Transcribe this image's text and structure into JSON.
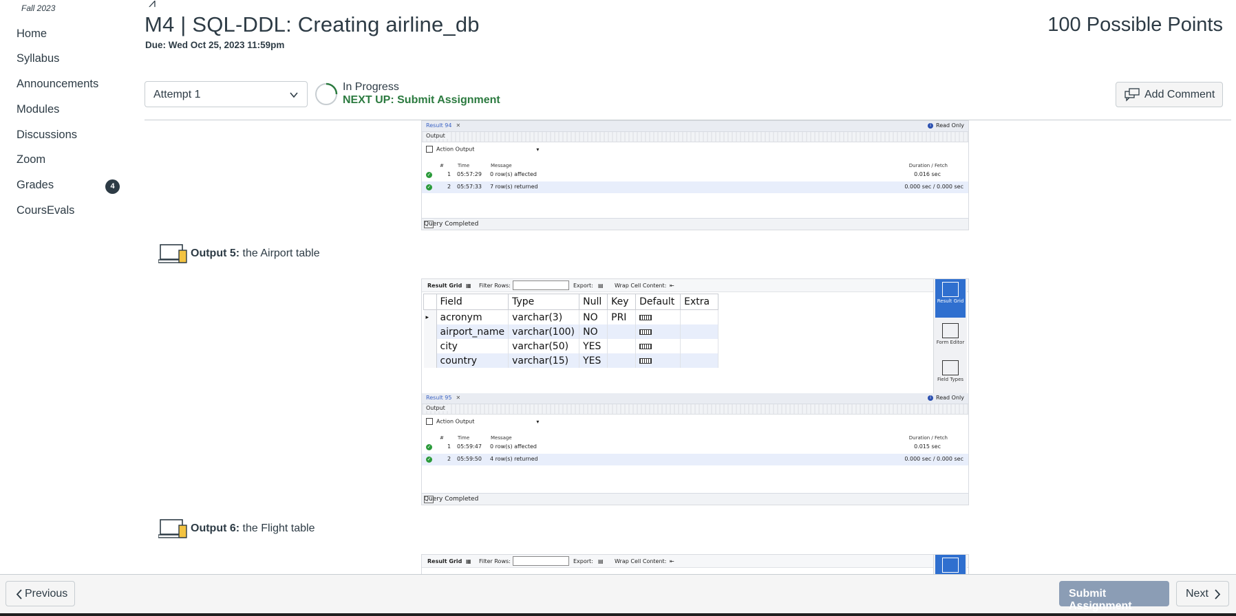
{
  "course": {
    "term": "Fall 2023",
    "nav": [
      {
        "label": "Home"
      },
      {
        "label": "Syllabus"
      },
      {
        "label": "Announcements"
      },
      {
        "label": "Modules"
      },
      {
        "label": "Discussions"
      },
      {
        "label": "Zoom"
      },
      {
        "label": "Grades",
        "badge": "4"
      },
      {
        "label": "CoursEvals"
      }
    ]
  },
  "header": {
    "title": "M4 | SQL-DDL: Creating airline_db",
    "due": "Due: Wed Oct 25, 2023 11:59pm",
    "points": "100 Possible Points"
  },
  "attempt": {
    "selected": "Attempt 1",
    "status": "In Progress",
    "next_up": "NEXT UP: Submit Assignment",
    "add_comment": "Add Comment"
  },
  "output4_panel": {
    "tab": "Result 94",
    "read_only": "Read Only",
    "output_label": "Output",
    "action_output": "Action Output",
    "headers": {
      "num": "#",
      "time": "Time",
      "message": "Message",
      "duration": "Duration / Fetch"
    },
    "rows": [
      {
        "num": "1",
        "time": "05:57:29",
        "message": "0 row(s) affected",
        "duration": "0.016 sec"
      },
      {
        "num": "2",
        "time": "05:57:33",
        "message": "7 row(s) returned",
        "duration": "0.000 sec / 0.000 sec"
      }
    ],
    "status": "Query Completed"
  },
  "output5": {
    "prefix": "Output 5:",
    "caption": "the Airport table",
    "toolbar": {
      "result_grid": "Result Grid",
      "filter_rows": "Filter Rows:",
      "export": "Export:",
      "wrap": "Wrap Cell Content:"
    },
    "side": {
      "result_grid": "Result Grid",
      "form_editor": "Form Editor",
      "field_types": "Field Types"
    },
    "columns": [
      "Field",
      "Type",
      "Null",
      "Key",
      "Default",
      "Extra"
    ],
    "rows": [
      {
        "field": "acronym",
        "type": "varchar(3)",
        "null": "NO",
        "key": "PRI"
      },
      {
        "field": "airport_name",
        "type": "varchar(100)",
        "null": "NO",
        "key": ""
      },
      {
        "field": "city",
        "type": "varchar(50)",
        "null": "YES",
        "key": ""
      },
      {
        "field": "country",
        "type": "varchar(15)",
        "null": "YES",
        "key": ""
      }
    ],
    "panel": {
      "tab": "Result 95",
      "read_only": "Read Only",
      "output_label": "Output",
      "action_output": "Action Output",
      "headers": {
        "num": "#",
        "time": "Time",
        "message": "Message",
        "duration": "Duration / Fetch"
      },
      "rows": [
        {
          "num": "1",
          "time": "05:59:47",
          "message": "0 row(s) affected",
          "duration": "0.015 sec"
        },
        {
          "num": "2",
          "time": "05:59:50",
          "message": "4 row(s) returned",
          "duration": "0.000 sec / 0.000 sec"
        }
      ],
      "status": "Query Completed"
    }
  },
  "output6": {
    "prefix": "Output 6:",
    "caption": "the Flight table",
    "toolbar": {
      "result_grid": "Result Grid",
      "filter_rows": "Filter Rows:",
      "export": "Export:",
      "wrap": "Wrap Cell Content:"
    }
  },
  "footer": {
    "previous": "Previous",
    "submit": "Submit Assignment",
    "next": "Next"
  },
  "colors": {
    "next_up": "#2b7a3f",
    "submit_bg": "#8b9db5",
    "badge_bg": "#2d3b45",
    "ok": "#2a9a3a"
  }
}
